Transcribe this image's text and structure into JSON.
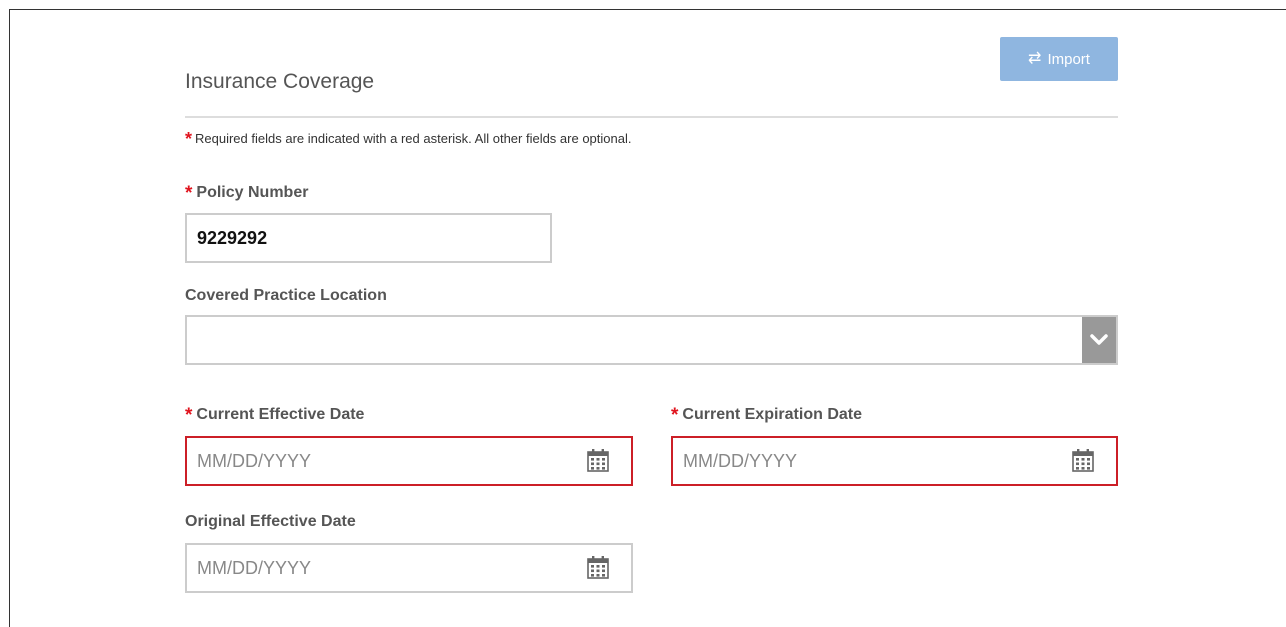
{
  "section": {
    "title": "Insurance Coverage"
  },
  "toolbar": {
    "import_label": "Import",
    "import_icon": "swap-arrows-icon"
  },
  "required_note": {
    "asterisk": "*",
    "text": "Required fields are indicated with a red asterisk. All other fields are optional."
  },
  "fields": {
    "policy_number": {
      "label": "Policy Number",
      "value": "9229292",
      "required": true
    },
    "covered_location": {
      "label": "Covered Practice Location",
      "value": ""
    },
    "current_effective": {
      "label": "Current Effective Date",
      "placeholder": "MM/DD/YYYY",
      "required": true
    },
    "current_expiration": {
      "label": "Current Expiration Date",
      "placeholder": "MM/DD/YYYY",
      "required": true
    },
    "original_effective": {
      "label": "Original Effective Date",
      "placeholder": "MM/DD/YYYY"
    }
  },
  "colors": {
    "accent": "#8fb6e0",
    "required": "#e0141e",
    "error_border": "#cc1f27"
  }
}
